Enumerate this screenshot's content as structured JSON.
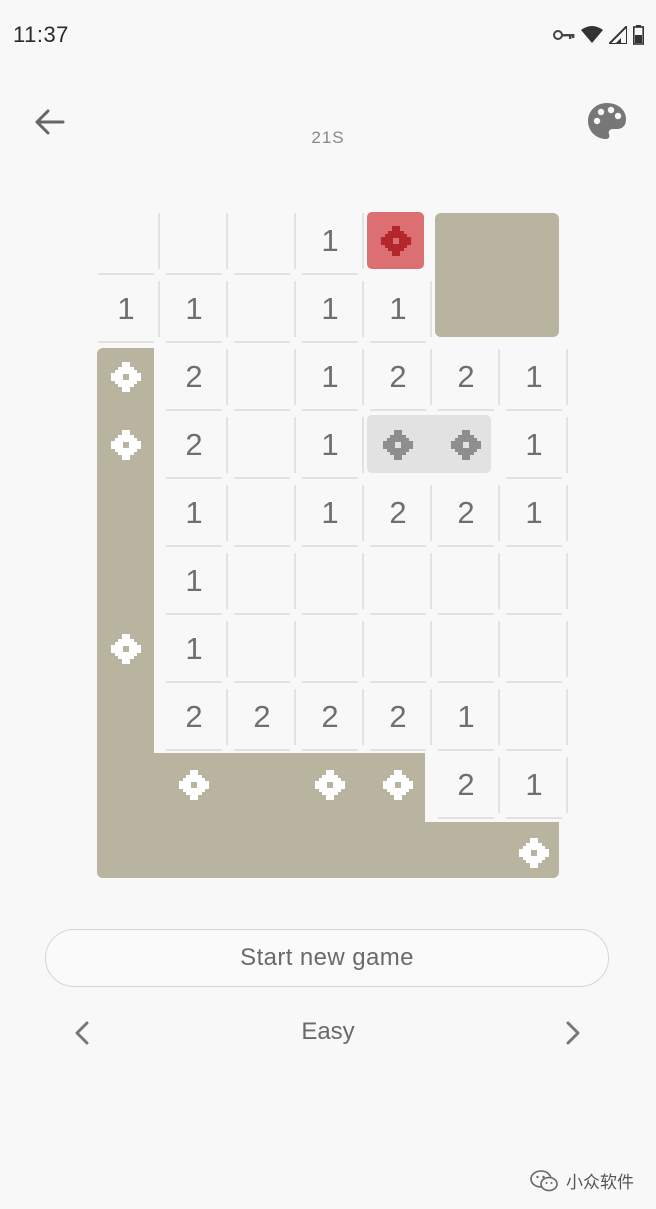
{
  "status": {
    "time": "11:37",
    "icons": [
      "key-icon",
      "wifi-icon",
      "signal-icon",
      "battery-icon"
    ]
  },
  "header": {
    "back_icon": "arrow-left-icon",
    "palette_icon": "palette-icon",
    "timer": "21S"
  },
  "board": {
    "columns": 7,
    "rows": 10,
    "unrevealed_color": "#b9b4a0",
    "exploded_color": "#dc6f72",
    "number_cells": [
      {
        "r": 0,
        "c": 3,
        "v": "1"
      },
      {
        "r": 1,
        "c": 0,
        "v": "1"
      },
      {
        "r": 1,
        "c": 1,
        "v": "1"
      },
      {
        "r": 1,
        "c": 3,
        "v": "1"
      },
      {
        "r": 1,
        "c": 4,
        "v": "1"
      },
      {
        "r": 2,
        "c": 1,
        "v": "2"
      },
      {
        "r": 2,
        "c": 3,
        "v": "1"
      },
      {
        "r": 2,
        "c": 4,
        "v": "2"
      },
      {
        "r": 2,
        "c": 5,
        "v": "2"
      },
      {
        "r": 2,
        "c": 6,
        "v": "1"
      },
      {
        "r": 3,
        "c": 1,
        "v": "2"
      },
      {
        "r": 3,
        "c": 3,
        "v": "1"
      },
      {
        "r": 3,
        "c": 6,
        "v": "1"
      },
      {
        "r": 4,
        "c": 1,
        "v": "1"
      },
      {
        "r": 4,
        "c": 3,
        "v": "1"
      },
      {
        "r": 4,
        "c": 4,
        "v": "2"
      },
      {
        "r": 4,
        "c": 5,
        "v": "2"
      },
      {
        "r": 4,
        "c": 6,
        "v": "1"
      },
      {
        "r": 5,
        "c": 1,
        "v": "1"
      },
      {
        "r": 6,
        "c": 1,
        "v": "1"
      },
      {
        "r": 7,
        "c": 1,
        "v": "2"
      },
      {
        "r": 7,
        "c": 2,
        "v": "2"
      },
      {
        "r": 7,
        "c": 3,
        "v": "2"
      },
      {
        "r": 7,
        "c": 4,
        "v": "2"
      },
      {
        "r": 7,
        "c": 5,
        "v": "1"
      },
      {
        "r": 8,
        "c": 5,
        "v": "2"
      },
      {
        "r": 8,
        "c": 6,
        "v": "1"
      }
    ],
    "empty_cells": [
      {
        "r": 0,
        "c": 0
      },
      {
        "r": 0,
        "c": 1
      },
      {
        "r": 0,
        "c": 2
      },
      {
        "r": 1,
        "c": 2
      },
      {
        "r": 2,
        "c": 2
      },
      {
        "r": 3,
        "c": 2
      },
      {
        "r": 4,
        "c": 2
      },
      {
        "r": 5,
        "c": 2
      },
      {
        "r": 5,
        "c": 3
      },
      {
        "r": 5,
        "c": 4
      },
      {
        "r": 5,
        "c": 5
      },
      {
        "r": 5,
        "c": 6
      },
      {
        "r": 6,
        "c": 2
      },
      {
        "r": 6,
        "c": 3
      },
      {
        "r": 6,
        "c": 4
      },
      {
        "r": 6,
        "c": 5
      },
      {
        "r": 6,
        "c": 6
      },
      {
        "r": 7,
        "c": 6
      }
    ],
    "unrevealed_mines": [
      {
        "r": 2,
        "c": 0
      },
      {
        "r": 3,
        "c": 0
      },
      {
        "r": 6,
        "c": 0
      },
      {
        "r": 8,
        "c": 1
      },
      {
        "r": 8,
        "c": 3
      },
      {
        "r": 8,
        "c": 4
      },
      {
        "r": 9,
        "c": 6
      }
    ],
    "highlighted_mines": [
      {
        "r": 3,
        "c": 4
      },
      {
        "r": 3,
        "c": 5
      }
    ],
    "exploded_mine": {
      "r": 0,
      "c": 4
    }
  },
  "controls": {
    "new_game_label": "Start new game",
    "difficulty": "Easy",
    "prev_icon": "chevron-left-icon",
    "next_icon": "chevron-right-icon"
  },
  "watermark": {
    "text": "小众软件",
    "icon": "wechat-icon"
  }
}
